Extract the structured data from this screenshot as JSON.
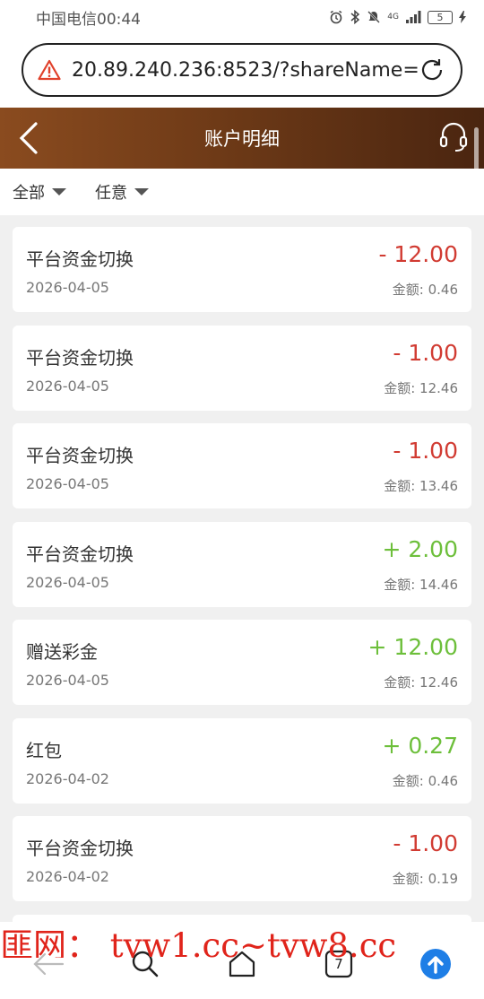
{
  "status_bar": {
    "carrier_time": "中国电信00:44",
    "network": "4G",
    "battery": "5"
  },
  "browser": {
    "url": "20.89.240.236:8523/?shareName="
  },
  "header": {
    "title": "账户明细"
  },
  "filters": [
    {
      "label": "全部"
    },
    {
      "label": "任意"
    }
  ],
  "balance_label": "金额: ",
  "transactions": [
    {
      "name": "平台资金切换",
      "date": "2026-04-05",
      "amount": "- 12.00",
      "balance": "金额: 0.46"
    },
    {
      "name": "平台资金切换",
      "date": "2026-04-05",
      "amount": "- 1.00",
      "balance": "金额: 12.46"
    },
    {
      "name": "平台资金切换",
      "date": "2026-04-05",
      "amount": "- 1.00",
      "balance": "金额: 13.46"
    },
    {
      "name": "平台资金切换",
      "date": "2026-04-05",
      "amount": "+ 2.00",
      "balance": "金额: 14.46"
    },
    {
      "name": "赠送彩金",
      "date": "2026-04-05",
      "amount": "+ 12.00",
      "balance": "金额: 12.46"
    },
    {
      "name": "红包",
      "date": "2026-04-02",
      "amount": "+ 0.27",
      "balance": "金额: 0.46"
    },
    {
      "name": "平台资金切换",
      "date": "2026-04-02",
      "amount": "- 1.00",
      "balance": "金额: 0.19"
    }
  ],
  "watermark": "匪网： tyw1.cc~tyw8.cc",
  "bottom_nav": {
    "tabs_count": "7"
  },
  "colors": {
    "header_brown": "#7a4119",
    "negative": "#d13b32",
    "positive": "#6dbf3b",
    "upload_blue": "#1e7ee6",
    "watermark_red": "#e0241b"
  }
}
